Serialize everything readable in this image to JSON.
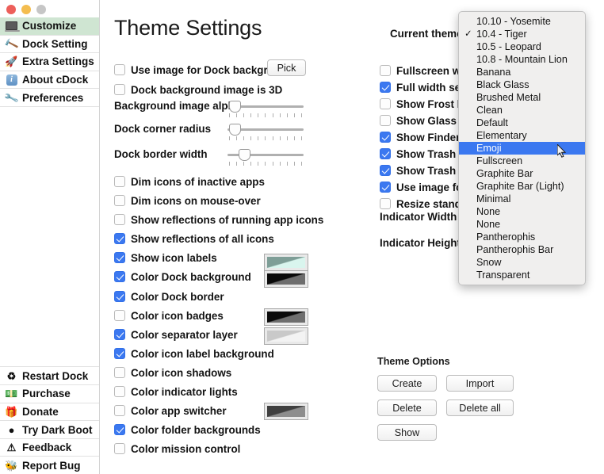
{
  "window": {
    "traffic_lights": [
      "close",
      "minimize",
      "zoom"
    ]
  },
  "sidebar": {
    "items_top": [
      {
        "label": "Customize",
        "icon": "laptop-icon",
        "selected": true
      },
      {
        "label": "Dock Setting",
        "icon": "hammer-icon",
        "selected": false
      },
      {
        "label": "Extra Settings",
        "icon": "rocket-icon",
        "selected": false
      },
      {
        "label": "About cDock",
        "icon": "info-icon",
        "selected": false
      },
      {
        "label": "Preferences",
        "icon": "screwdriver-icon",
        "selected": false
      }
    ],
    "items_bottom": [
      {
        "label": "Restart Dock",
        "icon": "recycle-icon"
      },
      {
        "label": "Purchase",
        "icon": "money-icon"
      },
      {
        "label": "Donate",
        "icon": "gift-icon"
      },
      {
        "label": "Try Dark Boot",
        "icon": "dark-circle-icon"
      },
      {
        "label": "Feedback",
        "icon": "warning-icon"
      },
      {
        "label": "Report Bug",
        "icon": "bug-icon"
      }
    ]
  },
  "main": {
    "title": "Theme Settings",
    "current_theme_label": "Current theme",
    "pick_button": "Pick",
    "left_column": {
      "image_checkbox": {
        "label": "Use image for Dock background",
        "checked": false
      },
      "threed_checkbox": {
        "label": "Dock background image is 3D",
        "checked": false
      },
      "sliders": [
        {
          "label": "Background image alpha",
          "value": 2
        },
        {
          "label": "Dock corner radius",
          "value": 2
        },
        {
          "label": "Dock border width",
          "value": 14
        }
      ],
      "checkboxes": [
        {
          "label": "Dim icons of inactive apps",
          "checked": false,
          "swatch": null
        },
        {
          "label": "Dim icons on mouse-over",
          "checked": false,
          "swatch": null
        },
        {
          "label": "Show reflections of running app icons",
          "checked": false,
          "swatch": null
        },
        {
          "label": "Show reflections of all icons",
          "checked": true,
          "swatch": null
        },
        {
          "label": "Show icon labels",
          "checked": true,
          "swatch": null
        },
        {
          "label": "Color Dock background",
          "checked": true,
          "swatch": "teal"
        },
        {
          "label": "Color Dock border",
          "checked": true,
          "swatch": "black"
        },
        {
          "label": "Color icon badges",
          "checked": false,
          "swatch": null
        },
        {
          "label": "Color separator layer",
          "checked": true,
          "swatch": "black"
        },
        {
          "label": "Color icon label background",
          "checked": true,
          "swatch": "light"
        },
        {
          "label": "Color icon shadows",
          "checked": false,
          "swatch": null
        },
        {
          "label": "Color indicator lights",
          "checked": false,
          "swatch": null
        },
        {
          "label": "Color app switcher",
          "checked": false,
          "swatch": null
        },
        {
          "label": "Color folder backgrounds",
          "checked": true,
          "swatch": "gray"
        },
        {
          "label": "Color mission control",
          "checked": false,
          "swatch": null
        }
      ]
    },
    "right_column": {
      "checkboxes": [
        {
          "label": "Fullscreen widt",
          "checked": false
        },
        {
          "label": "Full width sepa",
          "checked": true
        },
        {
          "label": "Show Frost laye",
          "checked": false
        },
        {
          "label": "Show Glass lay",
          "checked": false
        },
        {
          "label": "Show Finder ic",
          "checked": true
        },
        {
          "label": "Show Trash ico",
          "checked": true
        },
        {
          "label": "Show Trash iter",
          "checked": true
        },
        {
          "label": "Use image for a",
          "checked": true
        },
        {
          "label": "Resize standar",
          "checked": false
        }
      ],
      "indicator_width_label": "Indicator Width",
      "indicator_height_label": "Indicator Height"
    },
    "theme_options": {
      "title": "Theme Options",
      "buttons": [
        {
          "label": "Create"
        },
        {
          "label": "Import"
        },
        {
          "label": "Delete"
        },
        {
          "label": "Delete all"
        },
        {
          "label": "Show"
        }
      ]
    }
  },
  "dropdown": {
    "items": [
      {
        "label": "10.10 - Yosemite",
        "checked": false,
        "highlighted": false
      },
      {
        "label": "10.4 - Tiger",
        "checked": true,
        "highlighted": false
      },
      {
        "label": "10.5 - Leopard",
        "checked": false,
        "highlighted": false
      },
      {
        "label": "10.8 - Mountain Lion",
        "checked": false,
        "highlighted": false
      },
      {
        "label": "Banana",
        "checked": false,
        "highlighted": false
      },
      {
        "label": "Black Glass",
        "checked": false,
        "highlighted": false
      },
      {
        "label": "Brushed Metal",
        "checked": false,
        "highlighted": false
      },
      {
        "label": "Clean",
        "checked": false,
        "highlighted": false
      },
      {
        "label": "Default",
        "checked": false,
        "highlighted": false
      },
      {
        "label": "Elementary",
        "checked": false,
        "highlighted": false
      },
      {
        "label": "Emoji",
        "checked": false,
        "highlighted": true
      },
      {
        "label": "Fullscreen",
        "checked": false,
        "highlighted": false
      },
      {
        "label": "Graphite Bar",
        "checked": false,
        "highlighted": false
      },
      {
        "label": "Graphite Bar (Light)",
        "checked": false,
        "highlighted": false
      },
      {
        "label": "Minimal",
        "checked": false,
        "highlighted": false
      },
      {
        "label": "None",
        "checked": false,
        "highlighted": false
      },
      {
        "label": "None",
        "checked": false,
        "highlighted": false
      },
      {
        "label": "Pantherophis",
        "checked": false,
        "highlighted": false
      },
      {
        "label": "Pantherophis Bar",
        "checked": false,
        "highlighted": false
      },
      {
        "label": "Snow",
        "checked": false,
        "highlighted": false
      },
      {
        "label": "Transparent",
        "checked": false,
        "highlighted": false
      }
    ]
  },
  "colors": {
    "accent_blue": "#3b78f0",
    "selected_row_green": "#cfe5d2",
    "swatch_teal_from": "#7e9e97",
    "swatch_teal_to": "#d9f5ee",
    "swatch_black_from": "#0a0a0a",
    "swatch_black_to": "#6e6e6e",
    "swatch_light_from": "#c9c9c9",
    "swatch_light_to": "#f3f3f3",
    "swatch_gray_from": "#3f3f3f",
    "swatch_gray_to": "#8d8d8d"
  }
}
